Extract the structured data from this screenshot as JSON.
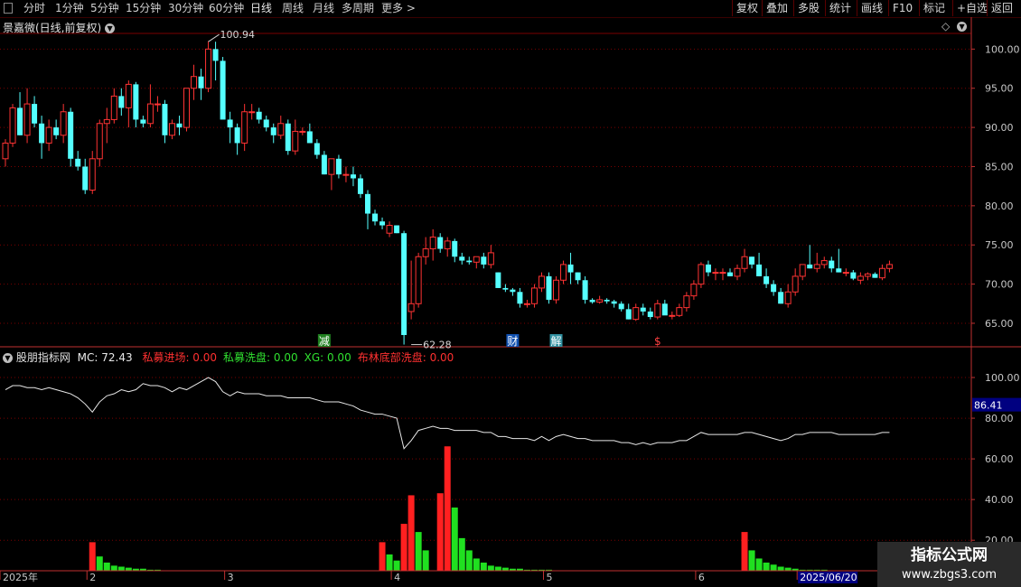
{
  "toolbar": {
    "periods": [
      {
        "label": "分时"
      },
      {
        "label": "1分钟"
      },
      {
        "label": "5分钟"
      },
      {
        "label": "15分钟"
      },
      {
        "label": "30分钟"
      },
      {
        "label": "60分钟"
      },
      {
        "label": "日线",
        "active": true
      },
      {
        "label": "周线"
      },
      {
        "label": "月线"
      },
      {
        "label": "多周期"
      },
      {
        "label": "更多 >"
      }
    ],
    "actions": [
      {
        "label": "复权"
      },
      {
        "label": "叠加"
      },
      {
        "label": "多股"
      },
      {
        "label": "统计"
      },
      {
        "label": "画线"
      },
      {
        "label": "F10"
      },
      {
        "label": "标记"
      },
      {
        "label": "+自选"
      },
      {
        "label": "返回"
      }
    ]
  },
  "main_title": "景嘉微(日线,前复权)",
  "indicator": {
    "name": "股朋指标网",
    "mc": "MC: 72.43",
    "items": [
      {
        "text": "私募进场: 0.00",
        "color": "#ff3030"
      },
      {
        "text": "私募洗盘: 0.00",
        "color": "#30e030"
      },
      {
        "text": "XG: 0.00",
        "color": "#30e030"
      },
      {
        "text": "布林底部洗盘: 0.00",
        "color": "#ff3030"
      }
    ]
  },
  "colors": {
    "up": "#ff3333",
    "down": "#55ffff",
    "grid": "#7a0000",
    "axis": "#c03030",
    "tick": "#c8c8c8",
    "line": "#e8e8e8",
    "bar_up": "#ff2020",
    "bar_green": "#20e020"
  },
  "markers": [
    {
      "text": "减",
      "bg": "#208020",
      "fg": "#ffffff",
      "index": 44
    },
    {
      "text": "财",
      "bg": "#1050b0",
      "fg": "#ffffff",
      "index": 70
    },
    {
      "text": "解",
      "bg": "#3090a0",
      "fg": "#ffffff",
      "index": 76
    },
    {
      "text": "$",
      "bg": "",
      "fg": "#ff4040",
      "index": 90
    }
  ],
  "watermark": {
    "line1": "指标公式网",
    "line2": "www.zbgs3.com"
  },
  "date_axis": [
    {
      "label": "2025年",
      "index": 0
    },
    {
      "label": "2",
      "index": 12
    },
    {
      "label": "3",
      "index": 31
    },
    {
      "label": "4",
      "index": 54
    },
    {
      "label": "5",
      "index": 75
    },
    {
      "label": "6",
      "index": 96
    },
    {
      "label": "2025/06/20",
      "index": 110,
      "highlight": true
    }
  ],
  "chart_data": [
    {
      "type": "candlestick",
      "title": "景嘉微(日线,前复权)",
      "ylim": [
        62,
        102
      ],
      "yticks": [
        65.0,
        70.0,
        75.0,
        80.0,
        85.0,
        90.0,
        95.0,
        100.0
      ],
      "annotations": [
        {
          "text": "100.94",
          "index": 28,
          "value": 100.94
        },
        {
          "text": "62.28",
          "index": 56,
          "value": 62.28
        }
      ],
      "ohlc": [
        [
          86,
          88.5,
          85,
          88
        ],
        [
          88,
          93,
          87.5,
          92.5
        ],
        [
          92.5,
          94.5,
          89,
          89
        ],
        [
          89,
          95,
          88,
          93
        ],
        [
          93,
          94,
          90,
          90.5
        ],
        [
          90.5,
          91.5,
          86,
          88
        ],
        [
          88,
          91,
          87,
          90
        ],
        [
          90,
          91,
          88.5,
          89
        ],
        [
          89,
          93,
          88,
          92
        ],
        [
          92,
          92.5,
          85,
          86
        ],
        [
          86,
          87,
          84.5,
          85
        ],
        [
          85,
          86,
          81.5,
          82
        ],
        [
          82,
          87,
          81.5,
          86
        ],
        [
          86,
          91,
          85,
          90.5
        ],
        [
          90.5,
          92.5,
          88,
          91
        ],
        [
          91,
          95,
          90.5,
          94
        ],
        [
          94,
          95,
          91.5,
          92.5
        ],
        [
          92.5,
          96,
          90,
          95.5
        ],
        [
          95.5,
          95.8,
          90,
          91
        ],
        [
          91,
          91.5,
          90,
          90.5
        ],
        [
          90.5,
          95.5,
          90,
          93
        ],
        [
          93,
          94,
          92,
          93
        ],
        [
          93,
          93.5,
          88,
          89
        ],
        [
          89,
          91,
          88.5,
          90.5
        ],
        [
          90.5,
          91.5,
          89,
          90
        ],
        [
          90,
          95,
          89.5,
          95
        ],
        [
          95,
          98,
          93.5,
          96.5
        ],
        [
          96.5,
          97.5,
          93.5,
          95
        ],
        [
          95,
          101,
          94.5,
          100
        ],
        [
          100,
          100.94,
          96,
          98.5
        ],
        [
          98.5,
          99,
          93,
          91
        ],
        [
          91,
          92,
          88,
          90
        ],
        [
          90,
          90.5,
          86.5,
          88
        ],
        [
          88,
          93,
          87,
          92
        ],
        [
          92,
          93,
          91,
          92
        ],
        [
          92,
          92.5,
          90.5,
          91
        ],
        [
          91,
          91.5,
          89.5,
          90
        ],
        [
          90,
          90.5,
          88,
          89
        ],
        [
          89,
          91.5,
          88.5,
          90.5
        ],
        [
          90.5,
          91,
          86.5,
          87
        ],
        [
          87,
          91,
          86.5,
          89.5
        ],
        [
          89.5,
          90,
          89,
          89.5
        ],
        [
          89.5,
          90.5,
          88,
          88
        ],
        [
          88,
          88.5,
          86,
          86.5
        ],
        [
          86.5,
          87,
          84,
          84
        ],
        [
          84,
          86,
          82,
          86
        ],
        [
          86,
          86.5,
          83.5,
          84
        ],
        [
          84,
          85,
          83,
          84
        ],
        [
          84,
          85,
          82.5,
          83.5
        ],
        [
          83.5,
          84,
          81,
          81.5
        ],
        [
          81.5,
          82,
          77,
          79
        ],
        [
          79,
          79.5,
          77.5,
          78
        ],
        [
          78,
          78.5,
          77,
          77.5
        ],
        [
          76.5,
          78,
          76,
          77.5
        ],
        [
          77.5,
          77.5,
          76.5,
          76.5
        ],
        [
          76.5,
          76.8,
          62.28,
          63.5
        ],
        [
          66.5,
          73,
          65.5,
          67.5
        ],
        [
          67.5,
          74,
          67,
          73.5
        ],
        [
          73.5,
          76,
          72.5,
          74.5
        ],
        [
          74.5,
          77,
          73,
          76
        ],
        [
          76,
          76.5,
          74,
          74.5
        ],
        [
          74.5,
          76,
          73.5,
          75.5
        ],
        [
          75.5,
          75.8,
          72.8,
          73.5
        ],
        [
          73.5,
          74,
          72.5,
          73
        ],
        [
          73,
          73.5,
          72.5,
          72.8
        ],
        [
          72.8,
          73.5,
          72,
          73.5
        ],
        [
          73.5,
          74,
          72,
          72.5
        ],
        [
          72.5,
          75,
          72,
          74
        ],
        [
          71.5,
          71.5,
          69.5,
          69.5
        ],
        [
          69.5,
          70,
          69,
          69.3
        ],
        [
          69.3,
          69.5,
          68.5,
          69
        ],
        [
          69,
          69.5,
          67,
          67.5
        ],
        [
          67.5,
          68,
          67,
          67.5
        ],
        [
          67.5,
          70,
          67,
          69.5
        ],
        [
          69.5,
          71.5,
          69,
          71
        ],
        [
          71,
          71.5,
          67.5,
          68
        ],
        [
          68,
          71,
          67.5,
          70.5
        ],
        [
          70.5,
          73,
          70,
          72.5
        ],
        [
          72.5,
          74,
          70,
          71.5
        ],
        [
          71.5,
          71.5,
          70,
          70.5
        ],
        [
          70.5,
          71,
          67.5,
          68
        ],
        [
          68,
          68.2,
          67.5,
          67.7
        ],
        [
          67.7,
          68.5,
          67.5,
          68
        ],
        [
          68,
          68.2,
          67.5,
          67.8
        ],
        [
          67.8,
          68,
          67,
          67.5
        ],
        [
          67.5,
          67.8,
          66.5,
          66.8
        ],
        [
          66.8,
          67.5,
          65.5,
          65.5
        ],
        [
          65.5,
          67.5,
          65.3,
          67
        ],
        [
          67,
          67.5,
          66,
          66.5
        ],
        [
          66.5,
          67,
          65.5,
          65.8
        ],
        [
          65.8,
          68,
          65.5,
          67.5
        ],
        [
          67.5,
          68,
          66.5,
          66
        ],
        [
          66,
          66.5,
          65.5,
          66
        ],
        [
          66,
          67.5,
          65.8,
          67
        ],
        [
          67,
          69,
          66.5,
          68.5
        ],
        [
          68.5,
          70.5,
          68,
          70
        ],
        [
          70,
          72.8,
          69.5,
          72.5
        ],
        [
          72.5,
          73,
          71,
          71.5
        ],
        [
          71.5,
          72,
          70.5,
          71.5
        ],
        [
          71.5,
          72,
          70.5,
          71.5
        ],
        [
          71.5,
          72,
          71,
          71
        ],
        [
          71,
          72.5,
          70.5,
          72
        ],
        [
          72,
          74.5,
          71.5,
          73.5
        ],
        [
          73.5,
          73.5,
          72,
          72.5
        ],
        [
          72.5,
          74,
          71,
          71
        ],
        [
          71,
          72,
          69.5,
          70
        ],
        [
          70,
          70.5,
          68.5,
          69
        ],
        [
          69,
          69.5,
          67.5,
          67.5
        ],
        [
          67.5,
          70,
          67,
          69
        ],
        [
          69,
          72,
          68.5,
          71
        ],
        [
          71,
          72.5,
          70.5,
          72.5
        ],
        [
          72.5,
          75,
          72,
          72
        ],
        [
          72,
          74,
          71.5,
          72.5
        ],
        [
          72.5,
          73.5,
          72,
          73
        ],
        [
          73,
          73.5,
          71.5,
          72
        ],
        [
          72,
          74.5,
          71.5,
          71.5
        ],
        [
          71.5,
          72,
          71,
          71.5
        ],
        [
          71.5,
          71.8,
          70.5,
          70.7
        ],
        [
          70.5,
          71.5,
          70,
          71
        ],
        [
          71,
          71.5,
          70.5,
          71.3
        ],
        [
          71.3,
          71.5,
          70.8,
          70.8
        ],
        [
          70.8,
          72.5,
          70.5,
          72
        ],
        [
          72,
          73,
          71.5,
          72.5
        ]
      ]
    },
    {
      "type": "line",
      "name": "MC",
      "ylim": [
        5,
        108
      ],
      "yticks": [
        20.0,
        40.0,
        60.0,
        80.0,
        100.0
      ],
      "current_label": "86.41",
      "values": [
        94,
        96,
        96,
        95,
        95,
        94,
        95,
        94,
        93,
        92,
        90,
        87,
        83,
        88,
        91,
        92,
        94,
        93,
        94,
        97,
        96,
        96,
        95,
        93,
        95,
        94,
        96,
        98,
        100,
        98,
        93,
        91,
        93,
        92,
        92,
        92,
        91,
        91,
        91,
        90,
        90,
        90,
        90,
        89,
        88,
        88,
        88,
        87,
        86,
        84,
        83,
        82,
        82,
        81,
        80,
        65,
        69,
        74,
        75,
        76,
        75,
        75,
        74,
        74,
        74,
        74,
        73,
        73,
        71,
        71,
        70,
        70,
        70,
        69,
        71,
        69,
        71,
        72,
        71,
        70,
        70,
        69,
        69,
        69,
        69,
        68,
        68,
        67,
        68,
        67,
        68,
        68,
        68,
        69,
        69,
        71,
        73,
        72,
        72,
        72,
        72,
        72,
        73,
        73,
        72,
        71,
        70,
        69,
        70,
        72,
        72,
        73,
        73,
        73,
        73,
        72,
        72,
        72,
        72,
        72,
        72,
        73,
        73
      ]
    },
    {
      "type": "bar",
      "name": "私募进场 / 私募洗盘",
      "red": [
        [
          12,
          14
        ],
        [
          52,
          14
        ],
        [
          55,
          23
        ],
        [
          56,
          37
        ],
        [
          60,
          38
        ],
        [
          61,
          61
        ],
        [
          102,
          19
        ]
      ],
      "green": [
        [
          13,
          7
        ],
        [
          14,
          4
        ],
        [
          15,
          2.5
        ],
        [
          16,
          2
        ],
        [
          17,
          1.5
        ],
        [
          18,
          1
        ],
        [
          19,
          1
        ],
        [
          20,
          0.5
        ],
        [
          21,
          0.5
        ],
        [
          53,
          8
        ],
        [
          54,
          5
        ],
        [
          57,
          19
        ],
        [
          58,
          10
        ],
        [
          62,
          31
        ],
        [
          63,
          16
        ],
        [
          64,
          10
        ],
        [
          65,
          6
        ],
        [
          66,
          4
        ],
        [
          67,
          2.5
        ],
        [
          68,
          2
        ],
        [
          69,
          1.5
        ],
        [
          70,
          1
        ],
        [
          71,
          1
        ],
        [
          72,
          0.5
        ],
        [
          73,
          0.5
        ],
        [
          74,
          0.5
        ],
        [
          75,
          0.5
        ],
        [
          103,
          10
        ],
        [
          104,
          6
        ],
        [
          105,
          4
        ],
        [
          106,
          3
        ],
        [
          107,
          2
        ],
        [
          108,
          1.5
        ],
        [
          109,
          1
        ],
        [
          110,
          0.5
        ],
        [
          111,
          0.5
        ],
        [
          112,
          0.5
        ],
        [
          113,
          0.5
        ]
      ],
      "ylim": [
        0,
        62
      ]
    }
  ]
}
